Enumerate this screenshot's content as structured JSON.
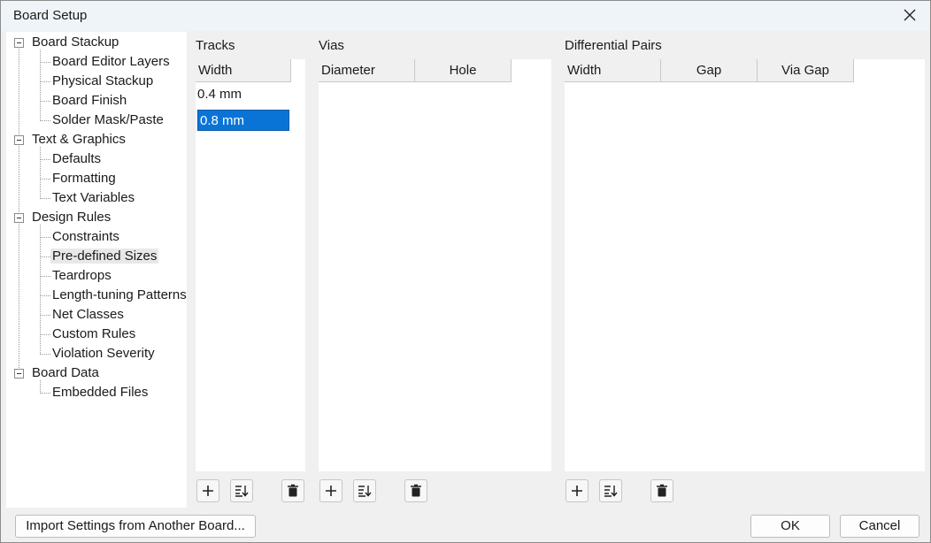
{
  "window": {
    "title": "Board Setup",
    "close_icon": "close-icon"
  },
  "tree": {
    "groups": [
      {
        "label": "Board Stackup",
        "children": [
          "Board Editor Layers",
          "Physical Stackup",
          "Board Finish",
          "Solder Mask/Paste"
        ]
      },
      {
        "label": "Text & Graphics",
        "children": [
          "Defaults",
          "Formatting",
          "Text Variables"
        ]
      },
      {
        "label": "Design Rules",
        "children": [
          "Constraints",
          "Pre-defined Sizes",
          "Teardrops",
          "Length-tuning Patterns",
          "Net Classes",
          "Custom Rules",
          "Violation Severity"
        ]
      },
      {
        "label": "Board Data",
        "children": [
          "Embedded Files"
        ]
      }
    ],
    "selected": "Pre-defined Sizes"
  },
  "tracks": {
    "label": "Tracks",
    "columns": [
      "Width"
    ],
    "rows": [
      "0.4 mm",
      "0.8 mm"
    ],
    "selected_row": 1
  },
  "vias": {
    "label": "Vias",
    "columns": [
      "Diameter",
      "Hole"
    ]
  },
  "diff_pairs": {
    "label": "Differential Pairs",
    "columns": [
      "Width",
      "Gap",
      "Via Gap"
    ]
  },
  "buttons": {
    "import": "Import Settings from Another Board...",
    "ok": "OK",
    "cancel": "Cancel"
  },
  "colors": {
    "selection": "#0a74d6",
    "titlebar": "#eff4f9"
  }
}
